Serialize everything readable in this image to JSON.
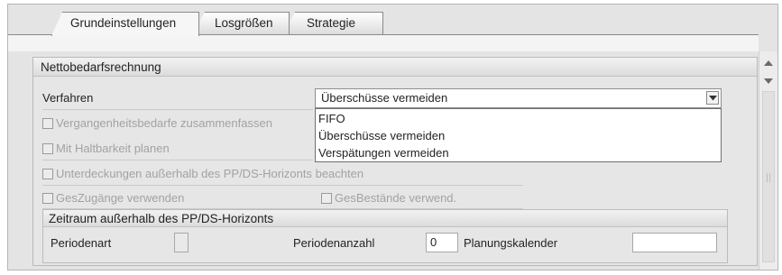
{
  "tabs": [
    {
      "label": "Grundeinstellungen",
      "active": true
    },
    {
      "label": "Losgrößen",
      "active": false
    },
    {
      "label": "Strategie",
      "active": false
    }
  ],
  "group": {
    "title": "Nettobedarfsrechnung"
  },
  "verfahren": {
    "label": "Verfahren",
    "selected": "Überschüsse vermeiden",
    "options": [
      "FIFO",
      "Überschüsse vermeiden",
      "Verspätungen vermeiden"
    ]
  },
  "checkboxes": {
    "vergangenheit": "Vergangenheitsbedarfe zusammenfassen",
    "haltbarkeit": "Mit Haltbarkeit planen",
    "unterdeckungen": "Unterdeckungen außerhalb des PP/DS-Horizonts beachten",
    "geszugaenge": "GesZugänge verwenden",
    "gesbestaende": "GesBestände verwend."
  },
  "zeitraum": {
    "title": "Zeitraum außerhalb des PP/DS-Horizonts",
    "periodenart_label": "Periodenart",
    "periodenart_value": "",
    "periodenanzahl_label": "Periodenanzahl",
    "periodenanzahl_value": "0",
    "planungskalender_label": "Planungskalender",
    "planungskalender_value": ""
  },
  "colors": {
    "panel": "#e4e4e4",
    "disabled_text": "#a2a2a2",
    "border": "#8a8a8a"
  },
  "icons": [
    "dropdown-arrow-icon",
    "scroll-up-icon",
    "scroll-down-icon",
    "grip-icon"
  ]
}
